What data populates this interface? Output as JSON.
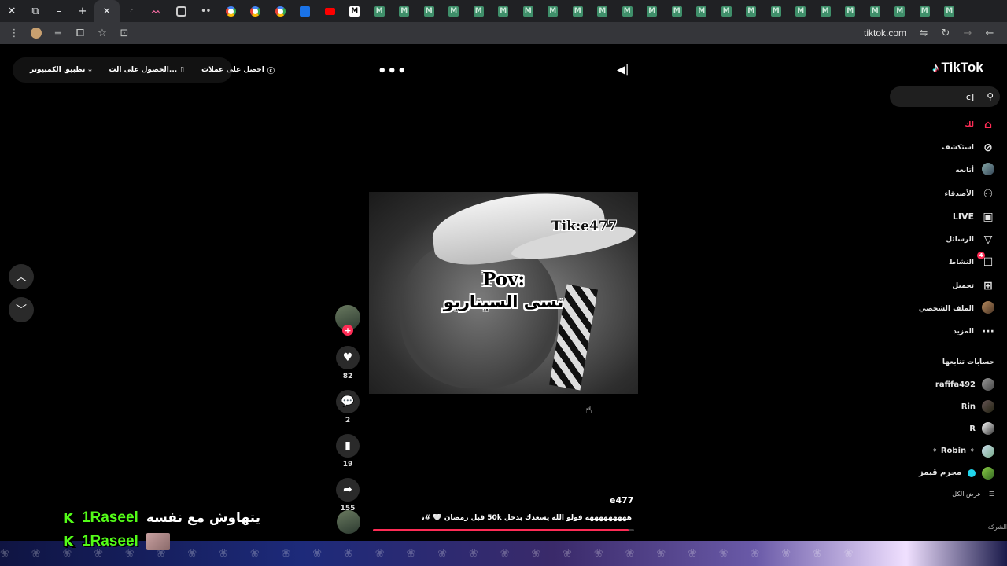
{
  "browser": {
    "tab_count_m": 24,
    "url": "tiktok.com"
  },
  "topbar": {
    "get_coins": "احصل على عملات",
    "get_app": "الحصول على الت...",
    "desktop_app": "تطبيق الكمبيوتر"
  },
  "video": {
    "watermark": "Tik:e477",
    "caption_line1": "Pov:",
    "caption_line2": "نسى السيناريو",
    "author": "e477",
    "description": "هههههههههه فولو الله يسعدك بدخل 50k قبل رمضان 🤍 #تيم_ريتش",
    "progress": 0.98
  },
  "actions": {
    "likes": "82",
    "comments": "2",
    "saves": "19",
    "shares": "155"
  },
  "sidebar": {
    "logo": "TikTok",
    "search_value": "c]",
    "nav": [
      {
        "label": "لك",
        "icon": "home-icon"
      },
      {
        "label": "استكشف",
        "icon": "compass-icon"
      },
      {
        "label": "أتابعه",
        "icon": "following-icon"
      },
      {
        "label": "الأصدقاء",
        "icon": "friends-icon"
      },
      {
        "label": "LIVE",
        "icon": "live-icon"
      },
      {
        "label": "الرسائل",
        "icon": "send-icon"
      },
      {
        "label": "النشاط",
        "icon": "activity-icon",
        "badge": "4"
      },
      {
        "label": "تحميل",
        "icon": "upload-icon"
      },
      {
        "label": "الملف الشخصي",
        "icon": "profile-icon"
      },
      {
        "label": "المزيد",
        "icon": "more-icon"
      }
    ],
    "following_title": "حسابات تتابعها",
    "following": [
      {
        "name": "rafifa492"
      },
      {
        "name": "Rin"
      },
      {
        "name": "R"
      },
      {
        "name": "✧ Robin ✧"
      },
      {
        "name": "مجرم قيمز"
      }
    ],
    "see_all": "عرض الكل",
    "company": "الشركة"
  },
  "stream_chat": [
    {
      "user": "1Raseel",
      "message": "يتهاوش مع نفسه"
    },
    {
      "user": "1Raseel",
      "message": ""
    }
  ],
  "colors": {
    "accent": "#fe2c55",
    "kick_green": "#53fc18",
    "background": "#000000"
  }
}
